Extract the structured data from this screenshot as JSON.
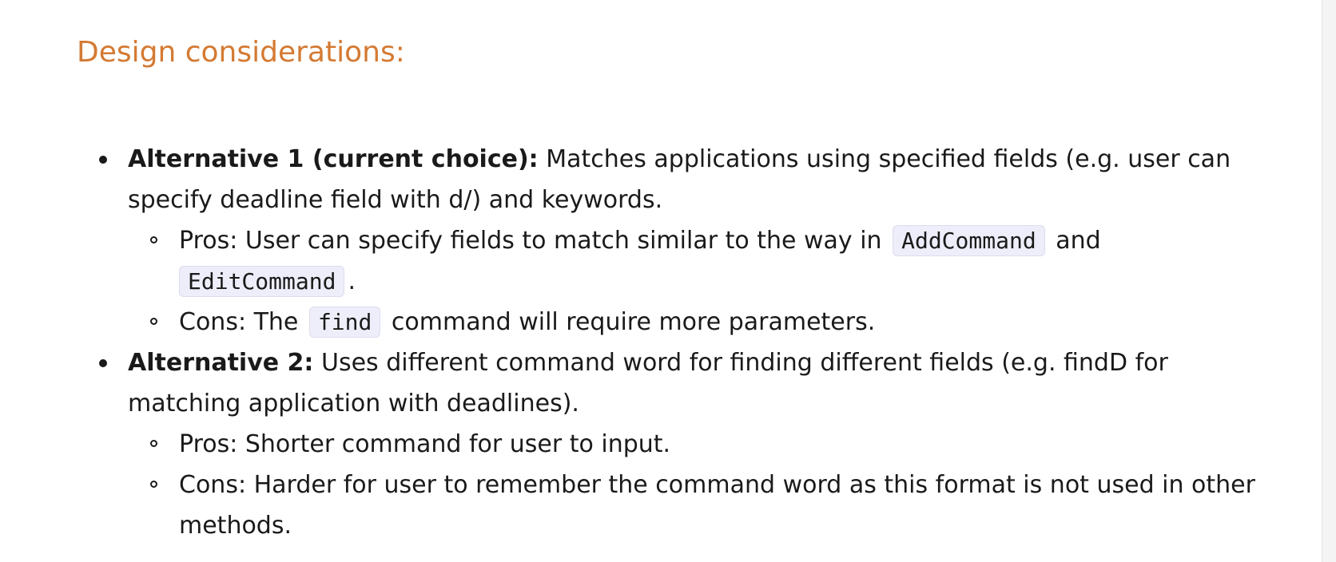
{
  "heading": "Design considerations:",
  "colors": {
    "heading": "#d47a33",
    "text": "#1a1a1a",
    "code_bg": "#eeeefa"
  },
  "alternatives": [
    {
      "label": "Alternative 1 (current choice):",
      "description": "Matches applications using specified fields (e.g. user can specify deadline field with d/) and keywords.",
      "pros": {
        "prefix": "Pros: User can specify fields to match similar to the way in",
        "code1": "AddCommand",
        "middle": "and",
        "code2": "EditCommand",
        "suffix": "."
      },
      "cons": {
        "prefix": "Cons: The",
        "code": "find",
        "suffix": "command will require more parameters."
      }
    },
    {
      "label": "Alternative 2:",
      "description": "Uses different command word for finding different fields (e.g. findD for matching application with deadlines).",
      "pros": "Pros: Shorter command for user to input.",
      "cons": "Cons: Harder for user to remember the command word as this format is not used in other methods."
    }
  ]
}
